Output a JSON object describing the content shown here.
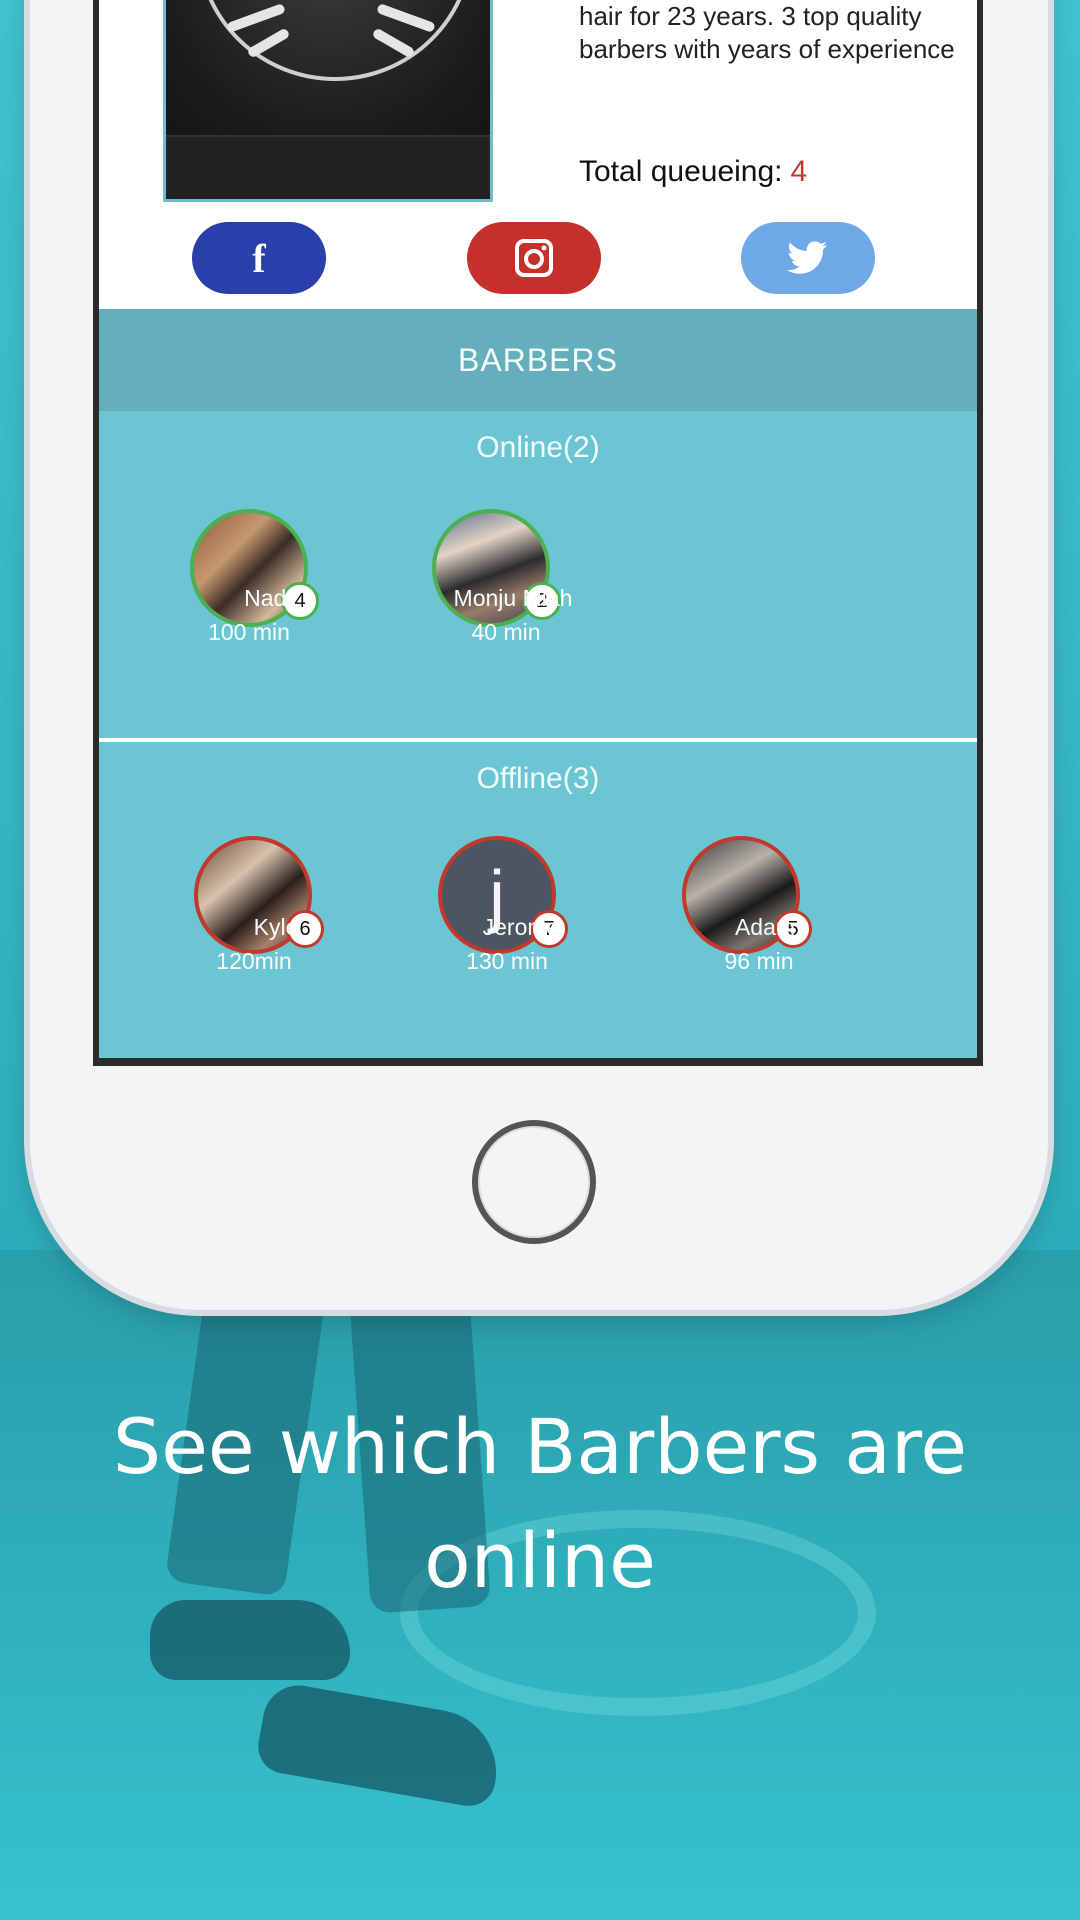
{
  "shop": {
    "description": "hair for 23 years. 3 top quality barbers with years of experience",
    "queue_label": "Total queueing:",
    "queue_count": "4"
  },
  "social": {
    "facebook_icon": "facebook-icon",
    "instagram_icon": "instagram-icon",
    "twitter_icon": "twitter-icon",
    "facebook_glyph": "f",
    "colors": {
      "facebook": "#2b3fab",
      "instagram": "#c5302b",
      "twitter": "#6fa8e6"
    }
  },
  "barbers": {
    "header": "BARBERS",
    "online_title": "Online(2)",
    "offline_title": "Offline(3)",
    "online": [
      {
        "name": "Nadz",
        "wait": "100 min",
        "queue": "4"
      },
      {
        "name": "Monju Miah",
        "wait": "40 min",
        "queue": "2"
      }
    ],
    "offline": [
      {
        "name": "Kyle",
        "wait": "120min",
        "queue": "6"
      },
      {
        "name": "Jerome",
        "wait": "130 min",
        "queue": "7",
        "initial": "j"
      },
      {
        "name": "Adam",
        "wait": "96  min",
        "queue": "5"
      }
    ],
    "colors": {
      "online": "#4caf50",
      "offline": "#c0392b"
    }
  },
  "caption": {
    "line1": "See which Barbers are",
    "line2": "online"
  }
}
